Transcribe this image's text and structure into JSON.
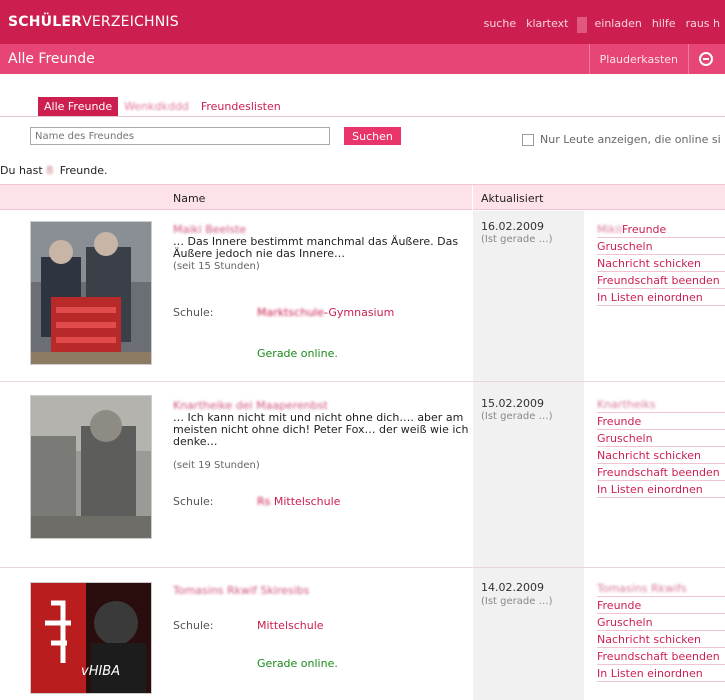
{
  "header": {
    "brand_bold": "SCHÜLER",
    "brand_light": "VERZEICHNIS",
    "nav": [
      "suche",
      "klartext",
      "einladen",
      "hilfe",
      "raus h"
    ]
  },
  "subheader": {
    "title": "Alle Freunde",
    "plauderkasten": "Plauderkasten",
    "colors": {
      "brand": "#cc1f4f",
      "subbar": "#e64575"
    }
  },
  "tabs": [
    {
      "label": "Alle Freunde",
      "active": true
    },
    {
      "label": "Wenkdkddd",
      "blurred": true
    },
    {
      "label": "Freundeslisten"
    }
  ],
  "search": {
    "placeholder": "Name des Freundes",
    "button_label": "Suchen",
    "online_label": "Nur Leute anzeigen, die online si"
  },
  "count": {
    "prefix": "Du hast",
    "value": "8",
    "suffix": "Freunde."
  },
  "table": {
    "col_name": "Name",
    "col_updated": "Aktualisiert"
  },
  "rows": [
    {
      "name": "Maiki Beelste",
      "quote": "… Das Innere bestimmt manchmal das Äußere. Das Äußere jedoch nie das Innere…",
      "since": "(seit 15 Stunden)",
      "school_label": "Schule:",
      "school_blur": "Marktschule",
      "school_value": "-Gymnasium",
      "online": "Gerade online.",
      "date": "16.02.2009",
      "status": "(Ist gerade …)",
      "actions": [
        {
          "blur": "Mikii",
          "label": "Freunde"
        },
        {
          "label": "Gruscheln"
        },
        {
          "label": "Nachricht schicken"
        },
        {
          "label": "Freundschaft beenden"
        },
        {
          "label": "In Listen einordnen"
        }
      ]
    },
    {
      "name": "Knartheike dei Maaperenbst",
      "quote": "… Ich kann nicht mit und nicht ohne dich…. aber am meisten nicht ohne dich! Peter Fox… der weiß wie ich denke…",
      "since": "(seit 19 Stunden)",
      "school_label": "Schule:",
      "school_blur": "Rs",
      "school_value": "Mittelschule",
      "online": "",
      "date": "15.02.2009",
      "status": "(Ist gerade …)",
      "actions": [
        {
          "blur": "Knartheiks"
        },
        {
          "label": "Freunde"
        },
        {
          "label": "Gruscheln"
        },
        {
          "label": "Nachricht schicken"
        },
        {
          "label": "Freundschaft beenden"
        },
        {
          "label": "In Listen einordnen"
        }
      ]
    },
    {
      "name": "Tomasins Rkwif Skiresibs",
      "quote": "",
      "since": "",
      "school_label": "Schule:",
      "school_blur": "",
      "school_value": "Mittelschule",
      "online": "Gerade online.",
      "date": "14.02.2009",
      "status": "(Ist gerade …)",
      "actions": [
        {
          "blur": "Tomasins Rkwifs"
        },
        {
          "label": "Freunde"
        },
        {
          "label": "Gruscheln"
        },
        {
          "label": "Nachricht schicken"
        },
        {
          "label": "Freundschaft beenden"
        },
        {
          "label": "In Listen einordnen"
        }
      ]
    }
  ],
  "photo3_text": "vHIBA"
}
